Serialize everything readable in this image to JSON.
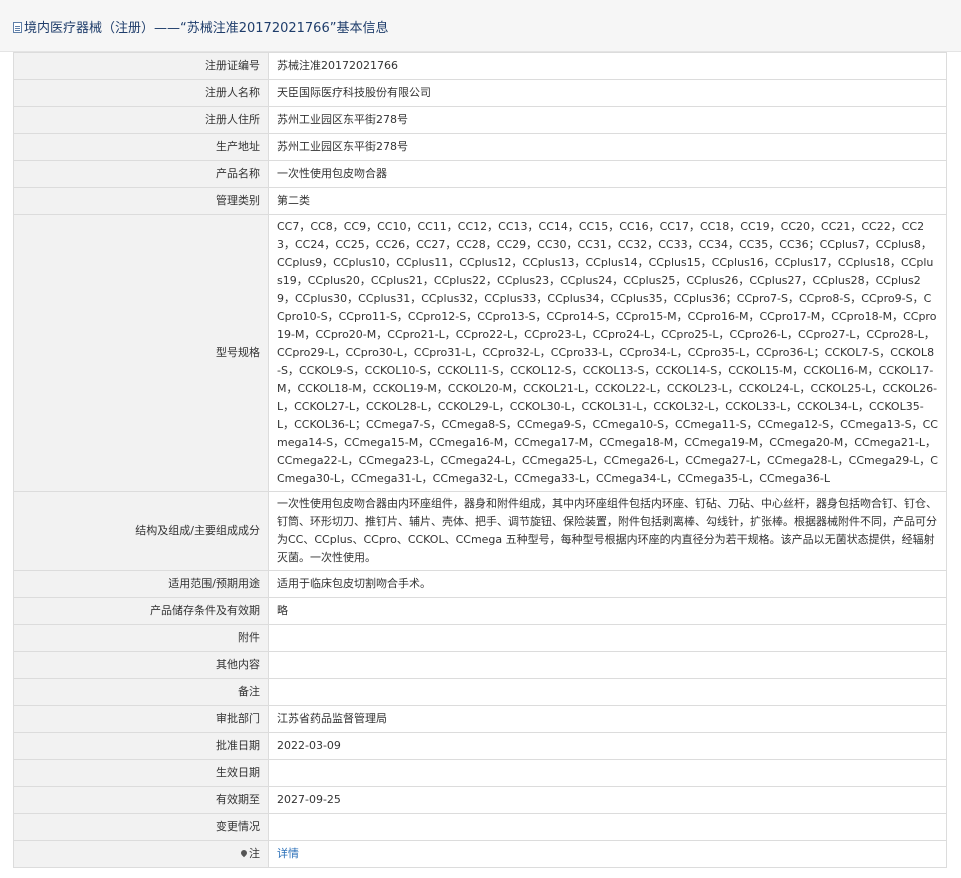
{
  "header": {
    "title": "境内医疗器械（注册）——“苏械注准20172021766”基本信息"
  },
  "fields": [
    {
      "label": "注册证编号",
      "value": "苏械注准20172021766"
    },
    {
      "label": "注册人名称",
      "value": "天臣国际医疗科技股份有限公司"
    },
    {
      "label": "注册人住所",
      "value": "苏州工业园区东平街278号"
    },
    {
      "label": "生产地址",
      "value": "苏州工业园区东平街278号"
    },
    {
      "label": "产品名称",
      "value": "一次性使用包皮吻合器"
    },
    {
      "label": "管理类别",
      "value": "第二类"
    },
    {
      "label": "型号规格",
      "value": "CC7，CC8，CC9，CC10，CC11，CC12，CC13，CC14，CC15，CC16，CC17，CC18，CC19，CC20，CC21，CC22，CC23，CC24，CC25，CC26，CC27，CC28，CC29，CC30，CC31，CC32，CC33，CC34，CC35，CC36；CCplus7，CCplus8，CCplus9，CCplus10，CCplus11，CCplus12，CCplus13，CCplus14，CCplus15，CCplus16，CCplus17，CCplus18，CCplus19，CCplus20，CCplus21，CCplus22，CCplus23，CCplus24，CCplus25，CCplus26，CCplus27，CCplus28，CCplus29，CCplus30，CCplus31，CCplus32，CCplus33，CCplus34，CCplus35，CCplus36；CCpro7-S，CCpro8-S，CCpro9-S，CCpro10-S，CCpro11-S，CCpro12-S，CCpro13-S，CCpro14-S，CCpro15-M，CCpro16-M，CCpro17-M，CCpro18-M，CCpro19-M，CCpro20-M，CCpro21-L，CCpro22-L，CCpro23-L，CCpro24-L，CCpro25-L，CCpro26-L，CCpro27-L，CCpro28-L，CCpro29-L，CCpro30-L，CCpro31-L，CCpro32-L，CCpro33-L，CCpro34-L，CCpro35-L，CCpro36-L；CCKOL7-S，CCKOL8-S，CCKOL9-S，CCKOL10-S，CCKOL11-S，CCKOL12-S，CCKOL13-S，CCKOL14-S，CCKOL15-M，CCKOL16-M，CCKOL17-M，CCKOL18-M，CCKOL19-M，CCKOL20-M，CCKOL21-L，CCKOL22-L，CCKOL23-L，CCKOL24-L，CCKOL25-L，CCKOL26-L，CCKOL27-L，CCKOL28-L，CCKOL29-L，CCKOL30-L，CCKOL31-L，CCKOL32-L，CCKOL33-L，CCKOL34-L，CCKOL35-L，CCKOL36-L；CCmega7-S，CCmega8-S，CCmega9-S，CCmega10-S，CCmega11-S，CCmega12-S，CCmega13-S，CCmega14-S，CCmega15-M，CCmega16-M，CCmega17-M，CCmega18-M，CCmega19-M，CCmega20-M，CCmega21-L，CCmega22-L，CCmega23-L，CCmega24-L，CCmega25-L，CCmega26-L，CCmega27-L，CCmega28-L，CCmega29-L，CCmega30-L，CCmega31-L，CCmega32-L，CCmega33-L，CCmega34-L，CCmega35-L，CCmega36-L"
    },
    {
      "label": "结构及组成/主要组成成分",
      "value": "一次性使用包皮吻合器由内环座组件，器身和附件组成，其中内环座组件包括内环座、钉砧、刀砧、中心丝杆，器身包括吻合钉、钉仓、钉筒、环形切刀、推钉片、辅片、壳体、把手、调节旋钮、保险装置，附件包括剥离棒、勾线针，扩张棒。根据器械附件不同，产品可分为CC、CCplus、CCpro、CCKOL、CCmega 五种型号，每种型号根据内环座的内直径分为若干规格。该产品以无菌状态提供，经辐射灭菌。一次性使用。"
    },
    {
      "label": "适用范围/预期用途",
      "value": "适用于临床包皮切割吻合手术。"
    },
    {
      "label": "产品储存条件及有效期",
      "value": "略"
    },
    {
      "label": "附件",
      "value": ""
    },
    {
      "label": "其他内容",
      "value": ""
    },
    {
      "label": "备注",
      "value": ""
    },
    {
      "label": "审批部门",
      "value": "江苏省药品监督管理局"
    },
    {
      "label": "批准日期",
      "value": "2022-03-09"
    },
    {
      "label": "生效日期",
      "value": ""
    },
    {
      "label": "有效期至",
      "value": "2027-09-25"
    },
    {
      "label": "变更情况",
      "value": ""
    },
    {
      "label": "注",
      "value": "详情"
    }
  ]
}
